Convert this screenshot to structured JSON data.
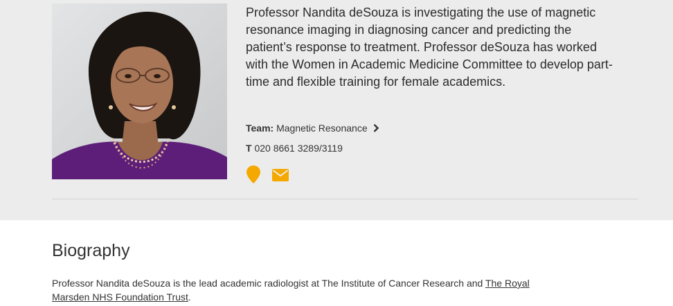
{
  "profile": {
    "summary": "Professor Nandita deSouza is investigating the use of magnetic resonance imaging in diagnosing cancer and predicting the patient’s response to treatment. Professor deSouza has worked with the Women in Academic Medicine Committee to develop part-time and flexible training for female academics.",
    "team_label": "Team:",
    "team_name": "Magnetic Resonance",
    "phone_label": "T",
    "phone_number": "020 8661 3289/3119",
    "icons": {
      "location": "map-pin-icon",
      "email": "envelope-icon",
      "chevron": "chevron-right-icon"
    }
  },
  "biography": {
    "heading": "Biography",
    "text_before": "Professor Nandita deSouza is the lead academic radiologist at The Institute of Cancer Research and ",
    "link_text": "The Royal Marsden NHS Foundation Trust",
    "text_after": "."
  },
  "colors": {
    "accent": "#f5a800",
    "band_bg": "#ececec",
    "text": "#333333"
  }
}
